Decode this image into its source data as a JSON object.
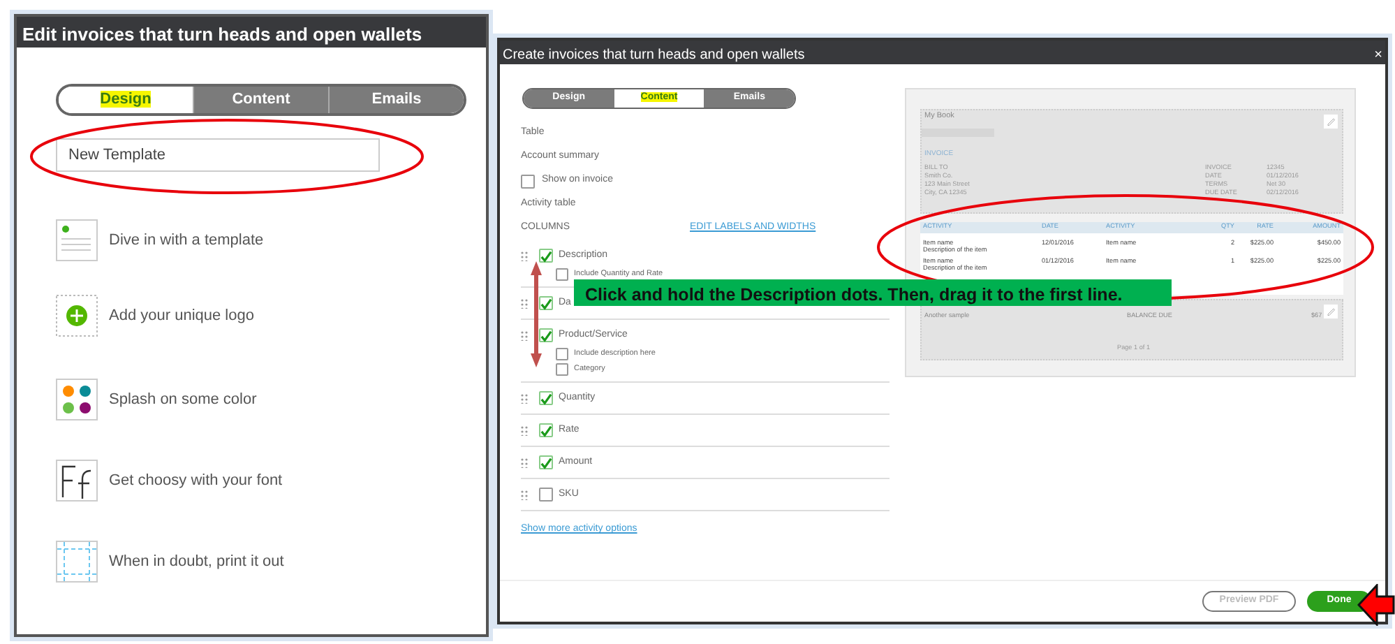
{
  "left_panel": {
    "title": "Edit invoices that turn heads and open wallets",
    "tabs": [
      {
        "label": "Design",
        "selected": true
      },
      {
        "label": "Content",
        "selected": false
      },
      {
        "label": "Emails",
        "selected": false
      }
    ],
    "template_name": "New Template",
    "features": [
      {
        "kind": "template",
        "label": "Dive in with a template"
      },
      {
        "kind": "logo",
        "label": "Add your unique logo"
      },
      {
        "kind": "color",
        "label": "Splash on some color"
      },
      {
        "kind": "font",
        "label": "Get choosy with your font"
      },
      {
        "kind": "print",
        "label": "When in doubt, print it out"
      }
    ]
  },
  "right_panel": {
    "title": "Create invoices that turn heads and open wallets",
    "close": "×",
    "tabs": [
      {
        "label": "Design",
        "selected": false
      },
      {
        "label": "Content",
        "selected": true
      },
      {
        "label": "Emails",
        "selected": false
      }
    ],
    "sections": [
      {
        "kind": "heading",
        "text": "Table"
      },
      {
        "kind": "heading",
        "text": "Account summary"
      },
      {
        "kind": "option",
        "text": "Show on invoice",
        "checked": false
      },
      {
        "kind": "heading",
        "text": "Activity table"
      }
    ],
    "columns_label": "COLUMNS",
    "columns_link": "EDIT LABELS AND WIDTHS",
    "columns": [
      {
        "label": "Description",
        "checked": true,
        "options": [
          {
            "label": "Include Quantity and Rate",
            "checked": false
          }
        ]
      },
      {
        "label": "Da",
        "checked": true
      },
      {
        "label": "Product/Service",
        "checked": true,
        "options": [
          {
            "label": "Include description here",
            "checked": false
          },
          {
            "label": "Category",
            "checked": false
          }
        ]
      },
      {
        "label": "Quantity",
        "checked": true
      },
      {
        "label": "Rate",
        "checked": true
      },
      {
        "label": "Amount",
        "checked": true
      },
      {
        "label": "SKU",
        "checked": false
      }
    ],
    "more_link": "Show more activity options",
    "preview": {
      "company": "My Book",
      "doc_title": "INVOICE",
      "bill_to": [
        "BILL TO",
        "Smith Co.",
        "123 Main Street",
        "City, CA 12345"
      ],
      "meta": [
        {
          "label": "INVOICE",
          "value": "12345"
        },
        {
          "label": "DATE",
          "value": "01/12/2016"
        },
        {
          "label": "TERMS",
          "value": "Net 30"
        },
        {
          "label": "DUE DATE",
          "value": "02/12/2016"
        }
      ],
      "columns": [
        "ACTIVITY",
        "DATE",
        "ACTIVITY",
        "QTY",
        "RATE",
        "AMOUNT"
      ],
      "rows": [
        {
          "cells": [
            "Item name",
            "12/01/2016",
            "Item name",
            "2",
            "$225.00",
            "$450.00"
          ],
          "note": "Description of the item"
        },
        {
          "cells": [
            "Item name",
            "01/12/2016",
            "Item name",
            "1",
            "$225.00",
            "$225.00"
          ],
          "note": "Description of the item"
        }
      ],
      "footer_note": "Another sample",
      "balance_label": "BALANCE DUE",
      "balance": "$67",
      "page": "Page 1 of 1"
    },
    "buttons": [
      {
        "label": "Preview PDF",
        "kind": "secondary"
      },
      {
        "label": "Done",
        "kind": "primary"
      }
    ]
  },
  "callout": "Click and hold the Description dots. Then, drag it to the first line."
}
